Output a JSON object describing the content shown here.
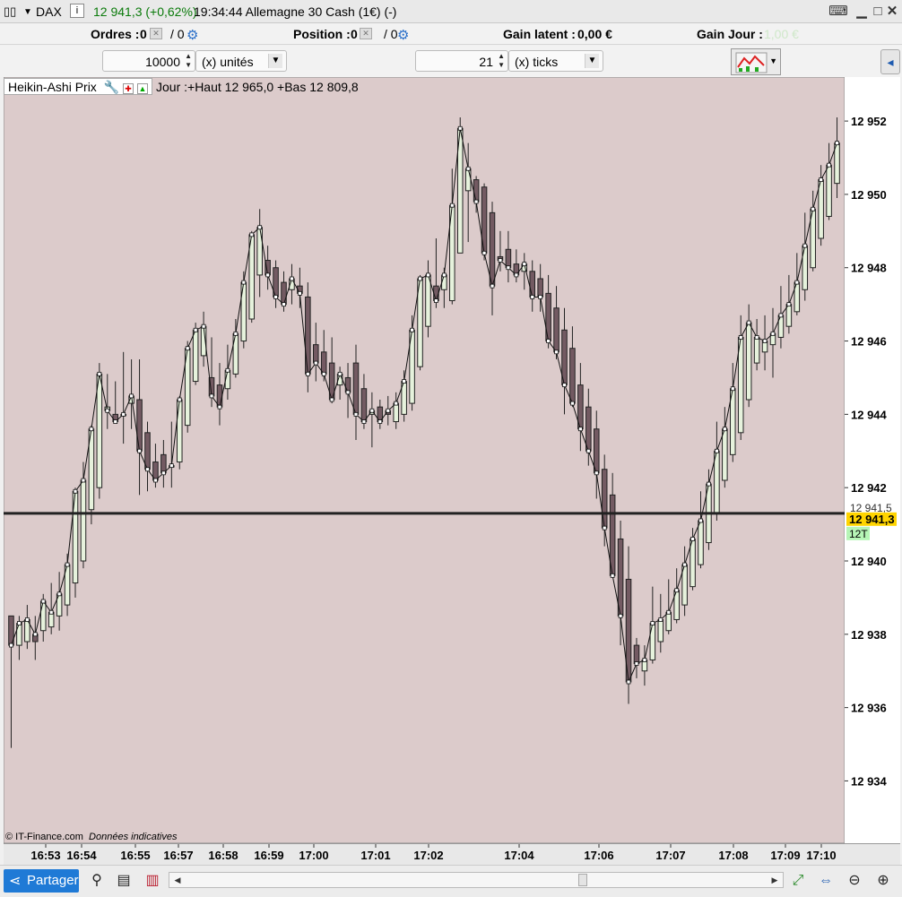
{
  "window": {
    "symbol": "DAX",
    "quote": "12 941,3 (+0,62%)",
    "time_title": "19:34:44 Allemagne 30 Cash (1€) (-)",
    "buttons": [
      "keyboard-icon",
      "minimize-icon",
      "maximize-icon",
      "close-icon"
    ]
  },
  "order_bar": {
    "orders_label": "Ordres :",
    "orders_value": "0",
    "orders_slash": "/ 0",
    "position_label": "Position :",
    "position_value": "0",
    "position_slash": "/ 0",
    "gain_latent_label": "Gain latent :",
    "gain_latent_value": "0,00 €",
    "gain_jour_label": "Gain Jour :",
    "gain_jour_value": "1,00 €"
  },
  "controls": {
    "quantity_value": "10000",
    "quantity_unit": "(x) unités",
    "tick_value": "21",
    "tick_unit": "(x) ticks"
  },
  "indicator": {
    "name": "Heikin-Ashi Prix",
    "info": "Jour :+Haut 12 965,0 +Bas 12 809,8"
  },
  "footer": {
    "source": "© IT-Finance.com",
    "note": "Données indicatives"
  },
  "price_axis": {
    "labels": [
      "12 952",
      "12 950",
      "12 948",
      "12 946",
      "12 944",
      "12 942",
      "12 940",
      "12 938",
      "12 936",
      "12 934"
    ],
    "secondary_label": "12 941,5",
    "current_label": "12 941,3",
    "current_color": "#ffd400",
    "tick_badge": "12T",
    "tick_badge_color": "#b6f5b6"
  },
  "time_axis": {
    "labels": [
      {
        "text": "16:53",
        "bold": false
      },
      {
        "text": "16:54",
        "bold": false
      },
      {
        "text": "16:55",
        "bold": false
      },
      {
        "text": "16:57",
        "bold": false
      },
      {
        "text": "16:58",
        "bold": false
      },
      {
        "text": "16:59",
        "bold": false
      },
      {
        "text": "17:00",
        "bold": true
      },
      {
        "text": "17:01",
        "bold": false
      },
      {
        "text": "17:02",
        "bold": false
      },
      {
        "text": "17:04",
        "bold": false
      },
      {
        "text": "17:06",
        "bold": false
      },
      {
        "text": "17:07",
        "bold": false
      },
      {
        "text": "17:08",
        "bold": false
      },
      {
        "text": "17:09",
        "bold": false
      },
      {
        "text": "17:10",
        "bold": false
      }
    ]
  },
  "bottom_bar": {
    "share_label": "Partager",
    "tools": [
      "draw-tools-icon",
      "list-icon",
      "indicator-icon"
    ],
    "right_tools": [
      "auto-scale-icon",
      "zoom-fit-icon",
      "zoom-out-icon",
      "zoom-in-icon"
    ]
  },
  "colors": {
    "chart_bg": "#dccbcb",
    "up_candle": "#e6f2dc",
    "down_candle": "#735a62",
    "current_line": "#222222"
  },
  "chart_data": {
    "type": "candlestick",
    "ylim": [
      12932.3,
      12953.2
    ],
    "current_price": 12941.3,
    "candles": [
      {
        "o": 12938.5,
        "h": 12937.8,
        "l": 12934.9,
        "c": 12937.7,
        "up": false
      },
      {
        "o": 12937.7,
        "h": 12938.5,
        "l": 12937.3,
        "c": 12938.3,
        "up": true
      },
      {
        "o": 12937.8,
        "h": 12938.8,
        "l": 12937.6,
        "c": 12938.4,
        "up": true
      },
      {
        "o": 12937.8,
        "h": 12938.5,
        "l": 12937.3,
        "c": 12938.0,
        "up": false
      },
      {
        "o": 12938.1,
        "h": 12939.1,
        "l": 12937.8,
        "c": 12938.9,
        "up": true
      },
      {
        "o": 12938.2,
        "h": 12939.4,
        "l": 12938.0,
        "c": 12938.6,
        "up": true
      },
      {
        "o": 12938.5,
        "h": 12939.7,
        "l": 12938.1,
        "c": 12939.1,
        "up": true
      },
      {
        "o": 12938.8,
        "h": 12940.2,
        "l": 12938.5,
        "c": 12939.9,
        "up": true
      },
      {
        "o": 12939.4,
        "h": 12942.0,
        "l": 12939.0,
        "c": 12941.9,
        "up": true
      },
      {
        "o": 12940.0,
        "h": 12942.7,
        "l": 12939.8,
        "c": 12942.2,
        "up": true
      },
      {
        "o": 12941.4,
        "h": 12943.7,
        "l": 12941.0,
        "c": 12943.6,
        "up": true
      },
      {
        "o": 12942.0,
        "h": 12945.4,
        "l": 12941.7,
        "c": 12945.1,
        "up": true
      },
      {
        "o": 12944.2,
        "h": 12945.1,
        "l": 12943.6,
        "c": 12944.1,
        "up": true
      },
      {
        "o": 12944.0,
        "h": 12944.9,
        "l": 12943.9,
        "c": 12943.8,
        "up": false
      },
      {
        "o": 12944.0,
        "h": 12945.7,
        "l": 12943.2,
        "c": 12944.0,
        "up": true
      },
      {
        "o": 12944.3,
        "h": 12945.5,
        "l": 12943.6,
        "c": 12944.5,
        "up": true
      },
      {
        "o": 12944.4,
        "h": 12945.5,
        "l": 12941.8,
        "c": 12943.0,
        "up": false
      },
      {
        "o": 12943.5,
        "h": 12943.8,
        "l": 12941.9,
        "c": 12942.5,
        "up": false
      },
      {
        "o": 12942.7,
        "h": 12943.2,
        "l": 12942.0,
        "c": 12942.2,
        "up": false
      },
      {
        "o": 12942.9,
        "h": 12943.3,
        "l": 12942.0,
        "c": 12942.4,
        "up": false
      },
      {
        "o": 12942.6,
        "h": 12943.8,
        "l": 12942.0,
        "c": 12942.6,
        "up": true
      },
      {
        "o": 12942.7,
        "h": 12944.5,
        "l": 12942.5,
        "c": 12944.4,
        "up": true
      },
      {
        "o": 12943.7,
        "h": 12946.0,
        "l": 12943.5,
        "c": 12945.8,
        "up": true
      },
      {
        "o": 12944.9,
        "h": 12946.5,
        "l": 12944.8,
        "c": 12946.3,
        "up": true
      },
      {
        "o": 12945.6,
        "h": 12946.8,
        "l": 12945.3,
        "c": 12946.4,
        "up": true
      },
      {
        "o": 12945.0,
        "h": 12946.1,
        "l": 12944.2,
        "c": 12944.5,
        "up": false
      },
      {
        "o": 12944.8,
        "h": 12945.4,
        "l": 12943.7,
        "c": 12944.2,
        "up": false
      },
      {
        "o": 12944.7,
        "h": 12945.9,
        "l": 12944.4,
        "c": 12945.2,
        "up": true
      },
      {
        "o": 12945.1,
        "h": 12946.6,
        "l": 12945.0,
        "c": 12946.2,
        "up": true
      },
      {
        "o": 12946.0,
        "h": 12947.9,
        "l": 12945.8,
        "c": 12947.6,
        "up": true
      },
      {
        "o": 12946.6,
        "h": 12949.0,
        "l": 12946.5,
        "c": 12948.9,
        "up": true
      },
      {
        "o": 12947.8,
        "h": 12949.6,
        "l": 12947.2,
        "c": 12949.1,
        "up": true
      },
      {
        "o": 12948.2,
        "h": 12948.6,
        "l": 12947.4,
        "c": 12947.8,
        "up": false
      },
      {
        "o": 12948.0,
        "h": 12948.2,
        "l": 12946.9,
        "c": 12947.2,
        "up": false
      },
      {
        "o": 12947.6,
        "h": 12947.9,
        "l": 12946.8,
        "c": 12947.0,
        "up": false
      },
      {
        "o": 12947.4,
        "h": 12948.1,
        "l": 12947.0,
        "c": 12947.7,
        "up": true
      },
      {
        "o": 12947.5,
        "h": 12948.0,
        "l": 12946.9,
        "c": 12947.3,
        "up": false
      },
      {
        "o": 12947.2,
        "h": 12947.6,
        "l": 12944.6,
        "c": 12945.1,
        "up": false
      },
      {
        "o": 12945.9,
        "h": 12946.5,
        "l": 12944.9,
        "c": 12945.4,
        "up": false
      },
      {
        "o": 12945.7,
        "h": 12946.3,
        "l": 12944.9,
        "c": 12945.1,
        "up": false
      },
      {
        "o": 12945.4,
        "h": 12946.1,
        "l": 12944.3,
        "c": 12944.4,
        "up": false
      },
      {
        "o": 12944.8,
        "h": 12945.3,
        "l": 12944.4,
        "c": 12945.1,
        "up": true
      },
      {
        "o": 12945.0,
        "h": 12945.4,
        "l": 12943.9,
        "c": 12944.6,
        "up": false
      },
      {
        "o": 12945.4,
        "h": 12945.9,
        "l": 12943.3,
        "c": 12944.0,
        "up": false
      },
      {
        "o": 12944.7,
        "h": 12945.1,
        "l": 12943.6,
        "c": 12943.8,
        "up": false
      },
      {
        "o": 12944.0,
        "h": 12944.6,
        "l": 12943.1,
        "c": 12944.1,
        "up": true
      },
      {
        "o": 12944.2,
        "h": 12944.4,
        "l": 12943.6,
        "c": 12943.8,
        "up": false
      },
      {
        "o": 12944.0,
        "h": 12944.5,
        "l": 12943.7,
        "c": 12944.1,
        "up": false
      },
      {
        "o": 12943.8,
        "h": 12944.6,
        "l": 12943.6,
        "c": 12944.3,
        "up": true
      },
      {
        "o": 12944.0,
        "h": 12945.2,
        "l": 12943.8,
        "c": 12944.9,
        "up": true
      },
      {
        "o": 12944.3,
        "h": 12946.7,
        "l": 12944.1,
        "c": 12946.3,
        "up": true
      },
      {
        "o": 12945.3,
        "h": 12947.8,
        "l": 12945.2,
        "c": 12947.7,
        "up": true
      },
      {
        "o": 12946.4,
        "h": 12948.2,
        "l": 12946.1,
        "c": 12947.8,
        "up": true
      },
      {
        "o": 12947.5,
        "h": 12948.8,
        "l": 12946.9,
        "c": 12947.1,
        "up": false
      },
      {
        "o": 12947.4,
        "h": 12948.0,
        "l": 12946.9,
        "c": 12947.8,
        "up": true
      },
      {
        "o": 12947.1,
        "h": 12950.7,
        "l": 12947.0,
        "c": 12949.7,
        "up": true
      },
      {
        "o": 12948.4,
        "h": 12952.1,
        "l": 12948.4,
        "c": 12951.8,
        "up": true
      },
      {
        "o": 12950.1,
        "h": 12951.4,
        "l": 12948.7,
        "c": 12950.7,
        "up": true
      },
      {
        "o": 12950.4,
        "h": 12950.5,
        "l": 12949.5,
        "c": 12949.8,
        "up": false
      },
      {
        "o": 12950.2,
        "h": 12950.3,
        "l": 12948.2,
        "c": 12948.4,
        "up": false
      },
      {
        "o": 12949.5,
        "h": 12949.8,
        "l": 12946.7,
        "c": 12947.5,
        "up": false
      },
      {
        "o": 12948.3,
        "h": 12949.0,
        "l": 12947.9,
        "c": 12948.2,
        "up": false
      },
      {
        "o": 12948.5,
        "h": 12949.0,
        "l": 12947.6,
        "c": 12948.0,
        "up": false
      },
      {
        "o": 12948.1,
        "h": 12948.5,
        "l": 12947.6,
        "c": 12947.8,
        "up": false
      },
      {
        "o": 12947.9,
        "h": 12948.4,
        "l": 12947.4,
        "c": 12948.1,
        "up": true
      },
      {
        "o": 12947.9,
        "h": 12948.2,
        "l": 12946.8,
        "c": 12947.2,
        "up": false
      },
      {
        "o": 12947.7,
        "h": 12948.1,
        "l": 12946.8,
        "c": 12947.2,
        "up": false
      },
      {
        "o": 12947.3,
        "h": 12947.8,
        "l": 12945.8,
        "c": 12946.0,
        "up": false
      },
      {
        "o": 12946.9,
        "h": 12947.5,
        "l": 12945.5,
        "c": 12945.7,
        "up": false
      },
      {
        "o": 12946.3,
        "h": 12946.9,
        "l": 12944.0,
        "c": 12944.8,
        "up": false
      },
      {
        "o": 12945.8,
        "h": 12946.4,
        "l": 12944.2,
        "c": 12944.3,
        "up": false
      },
      {
        "o": 12944.8,
        "h": 12945.4,
        "l": 12943.0,
        "c": 12943.6,
        "up": false
      },
      {
        "o": 12944.2,
        "h": 12944.7,
        "l": 12942.6,
        "c": 12943.0,
        "up": false
      },
      {
        "o": 12943.6,
        "h": 12944.1,
        "l": 12941.7,
        "c": 12942.4,
        "up": false
      },
      {
        "o": 12942.5,
        "h": 12942.9,
        "l": 12940.4,
        "c": 12940.9,
        "up": false
      },
      {
        "o": 12941.8,
        "h": 12942.4,
        "l": 12939.9,
        "c": 12939.6,
        "up": false
      },
      {
        "o": 12940.6,
        "h": 12941.1,
        "l": 12937.7,
        "c": 12938.5,
        "up": false
      },
      {
        "o": 12939.5,
        "h": 12940.4,
        "l": 12936.1,
        "c": 12936.7,
        "up": false
      },
      {
        "o": 12937.7,
        "h": 12937.9,
        "l": 12936.8,
        "c": 12937.2,
        "up": false
      },
      {
        "o": 12937.0,
        "h": 12937.7,
        "l": 12936.6,
        "c": 12937.3,
        "up": true
      },
      {
        "o": 12937.3,
        "h": 12939.3,
        "l": 12937.2,
        "c": 12938.3,
        "up": true
      },
      {
        "o": 12937.8,
        "h": 12939.1,
        "l": 12937.5,
        "c": 12938.4,
        "up": true
      },
      {
        "o": 12938.1,
        "h": 12939.5,
        "l": 12938.0,
        "c": 12938.6,
        "up": true
      },
      {
        "o": 12938.4,
        "h": 12939.8,
        "l": 12938.3,
        "c": 12939.2,
        "up": true
      },
      {
        "o": 12938.8,
        "h": 12940.4,
        "l": 12938.5,
        "c": 12939.9,
        "up": true
      },
      {
        "o": 12939.3,
        "h": 12940.9,
        "l": 12939.2,
        "c": 12940.6,
        "up": true
      },
      {
        "o": 12939.9,
        "h": 12941.9,
        "l": 12939.8,
        "c": 12941.1,
        "up": true
      },
      {
        "o": 12940.5,
        "h": 12942.5,
        "l": 12940.3,
        "c": 12942.1,
        "up": true
      },
      {
        "o": 12941.3,
        "h": 12943.8,
        "l": 12941.1,
        "c": 12943.0,
        "up": true
      },
      {
        "o": 12942.2,
        "h": 12944.2,
        "l": 12942.0,
        "c": 12943.6,
        "up": true
      },
      {
        "o": 12942.9,
        "h": 12945.4,
        "l": 12942.7,
        "c": 12944.7,
        "up": true
      },
      {
        "o": 12943.5,
        "h": 12946.7,
        "l": 12943.3,
        "c": 12946.1,
        "up": true
      },
      {
        "o": 12944.4,
        "h": 12947.0,
        "l": 12944.2,
        "c": 12946.5,
        "up": true
      },
      {
        "o": 12945.4,
        "h": 12946.6,
        "l": 12945.2,
        "c": 12946.1,
        "up": true
      },
      {
        "o": 12945.7,
        "h": 12946.7,
        "l": 12945.2,
        "c": 12946.0,
        "up": true
      },
      {
        "o": 12945.9,
        "h": 12946.9,
        "l": 12945.0,
        "c": 12946.2,
        "up": true
      },
      {
        "o": 12946.1,
        "h": 12947.5,
        "l": 12945.8,
        "c": 12946.7,
        "up": true
      },
      {
        "o": 12946.4,
        "h": 12947.8,
        "l": 12946.2,
        "c": 12947.0,
        "up": true
      },
      {
        "o": 12946.8,
        "h": 12948.4,
        "l": 12946.7,
        "c": 12947.6,
        "up": true
      },
      {
        "o": 12947.4,
        "h": 12949.5,
        "l": 12947.1,
        "c": 12948.6,
        "up": true
      },
      {
        "o": 12948.0,
        "h": 12950.1,
        "l": 12947.9,
        "c": 12949.6,
        "up": true
      },
      {
        "o": 12948.8,
        "h": 12950.8,
        "l": 12948.6,
        "c": 12950.4,
        "up": true
      },
      {
        "o": 12949.4,
        "h": 12951.4,
        "l": 12949.3,
        "c": 12950.8,
        "up": true
      },
      {
        "o": 12950.3,
        "h": 12952.1,
        "l": 12949.9,
        "c": 12951.4,
        "up": true
      }
    ]
  }
}
